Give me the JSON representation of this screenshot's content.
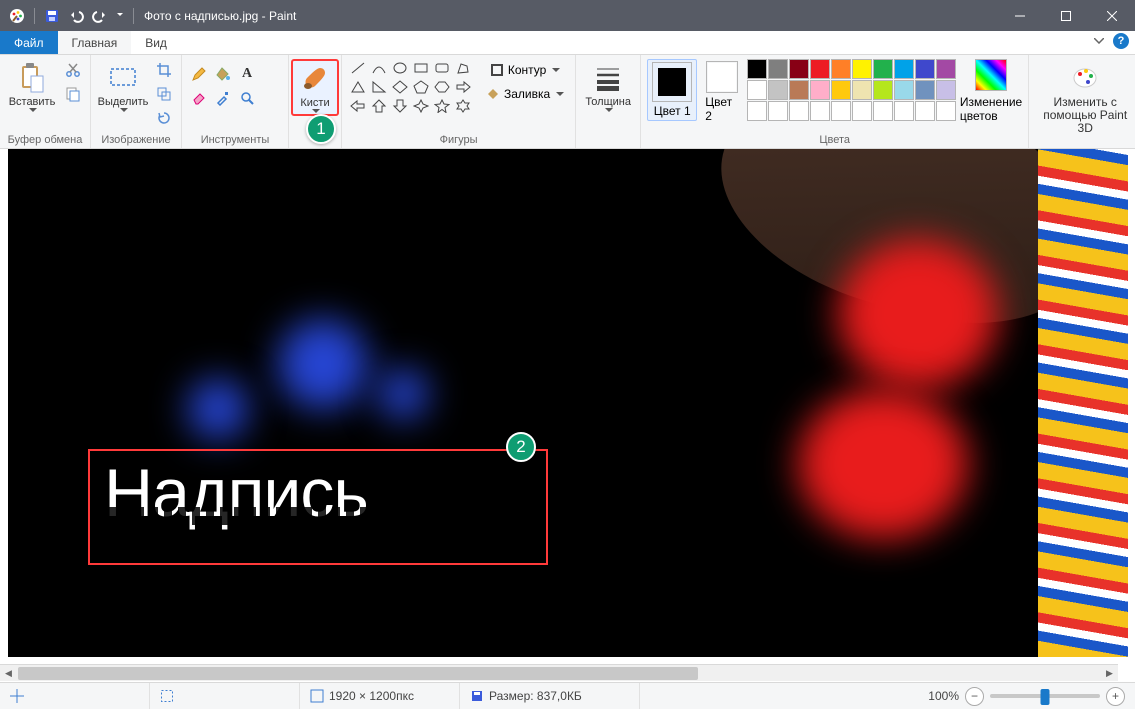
{
  "title": "Фото с надписью.jpg - Paint",
  "tabs": {
    "file": "Файл",
    "home": "Главная",
    "view": "Вид"
  },
  "ribbon": {
    "clipboard": {
      "paste": "Вставить",
      "label": "Буфер обмена"
    },
    "image": {
      "select": "Выделить",
      "label": "Изображение"
    },
    "tools": {
      "label": "Инструменты"
    },
    "brushes": {
      "label": "Кисти"
    },
    "shapes": {
      "outline": "Контур",
      "fill": "Заливка",
      "label": "Фигуры"
    },
    "size": {
      "label": "Толщина"
    },
    "colors": {
      "c1": "Цвет 1",
      "c2": "Цвет 2",
      "edit": "Изменение цветов",
      "label": "Цвета"
    },
    "paint3d": {
      "line1": "Изменить с",
      "line2": "помощью Paint 3D"
    }
  },
  "palette_row1": [
    "#000000",
    "#7f7f7f",
    "#880015",
    "#ed1c24",
    "#ff7f27",
    "#fff200",
    "#22b14c",
    "#00a2e8",
    "#3f48cc",
    "#a349a4"
  ],
  "palette_row2": [
    "#ffffff",
    "#c3c3c3",
    "#b97a57",
    "#ffaec9",
    "#ffc90e",
    "#efe4b0",
    "#b5e61d",
    "#99d9ea",
    "#7092be",
    "#c8bfe7"
  ],
  "canvas_text": "Надпись",
  "annotations": {
    "a1": "1",
    "a2": "2"
  },
  "status": {
    "dims": "1920 × 1200пкс",
    "size": "Размер: 837,0КБ",
    "zoom": "100%"
  },
  "color1": "#000000",
  "color2": "#ffffff"
}
